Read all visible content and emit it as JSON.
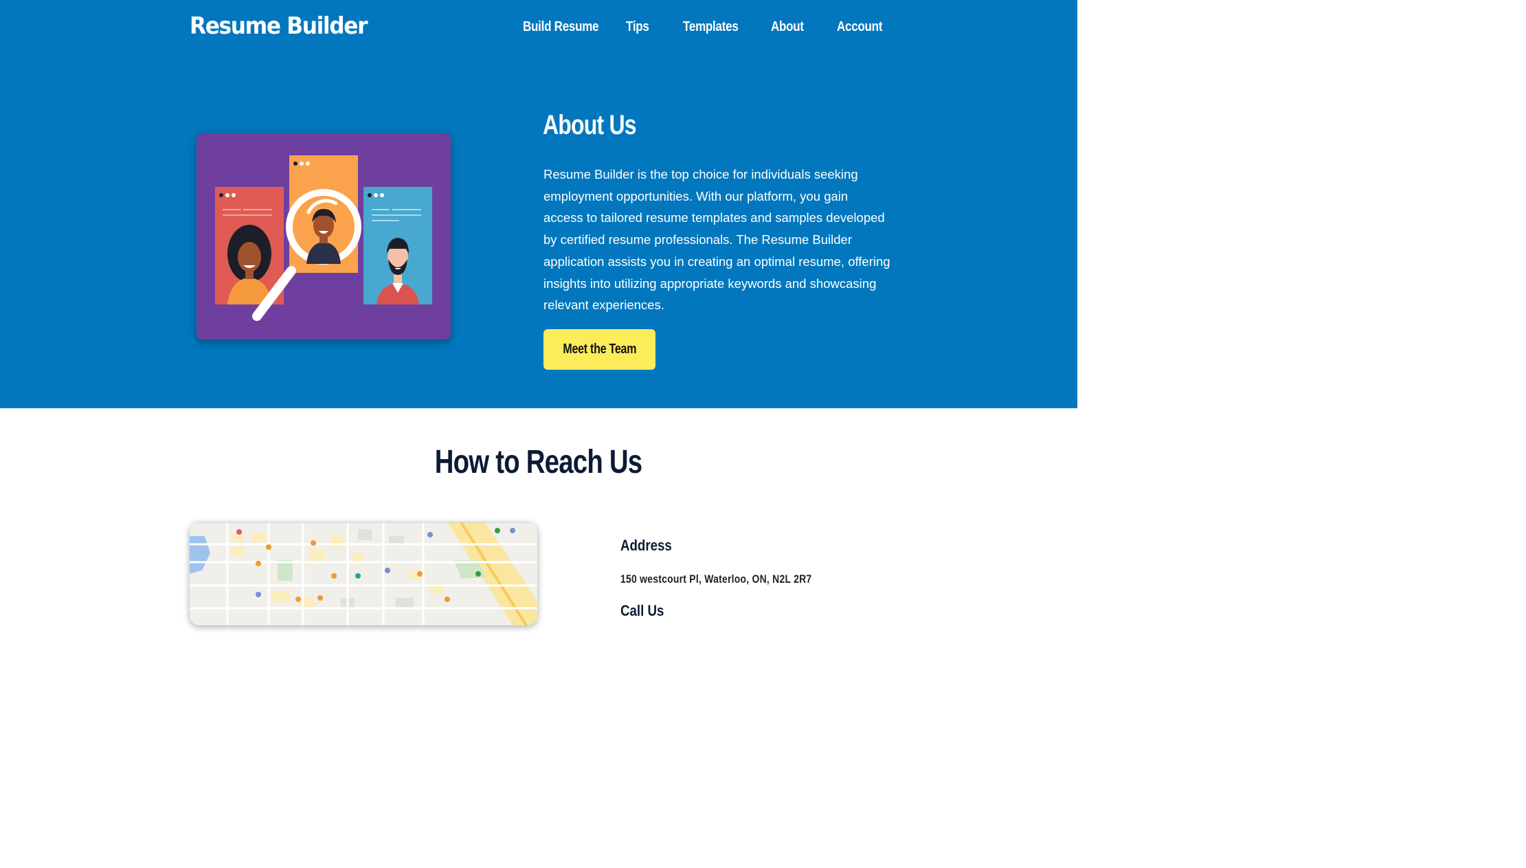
{
  "header": {
    "brand": "Resume Builder",
    "nav": [
      "Build Resume",
      "Tips",
      "Templates",
      "About",
      "Account"
    ]
  },
  "about": {
    "title": "About Us",
    "paragraph_lines": [
      "Resume Builder is the top choice for individuals seeking",
      "employment opportunities. With our platform, you gain",
      "access to tailored resume templates and samples developed",
      "by certified resume professionals. The Resume Builder",
      "application assists you in creating an optimal resume, offering",
      "insights into utilizing appropriate keywords and showcasing",
      "relevant experiences."
    ],
    "button_label": "Meet the Team"
  },
  "reach": {
    "title": "How to Reach Us",
    "address_label": "Address",
    "address_value": "150 westcourt Pl, Waterloo, ON, N2L 2R7",
    "call_label": "Call Us"
  },
  "colors": {
    "hero_bg": "#0277be",
    "button_bg": "#fcec5a",
    "heading_dark": "#0c1b35",
    "illustration_bg": "#6f3fa0"
  },
  "icons": [
    "magnifying-glass-icon",
    "person-avatar-icon",
    "map-pin-icon"
  ]
}
